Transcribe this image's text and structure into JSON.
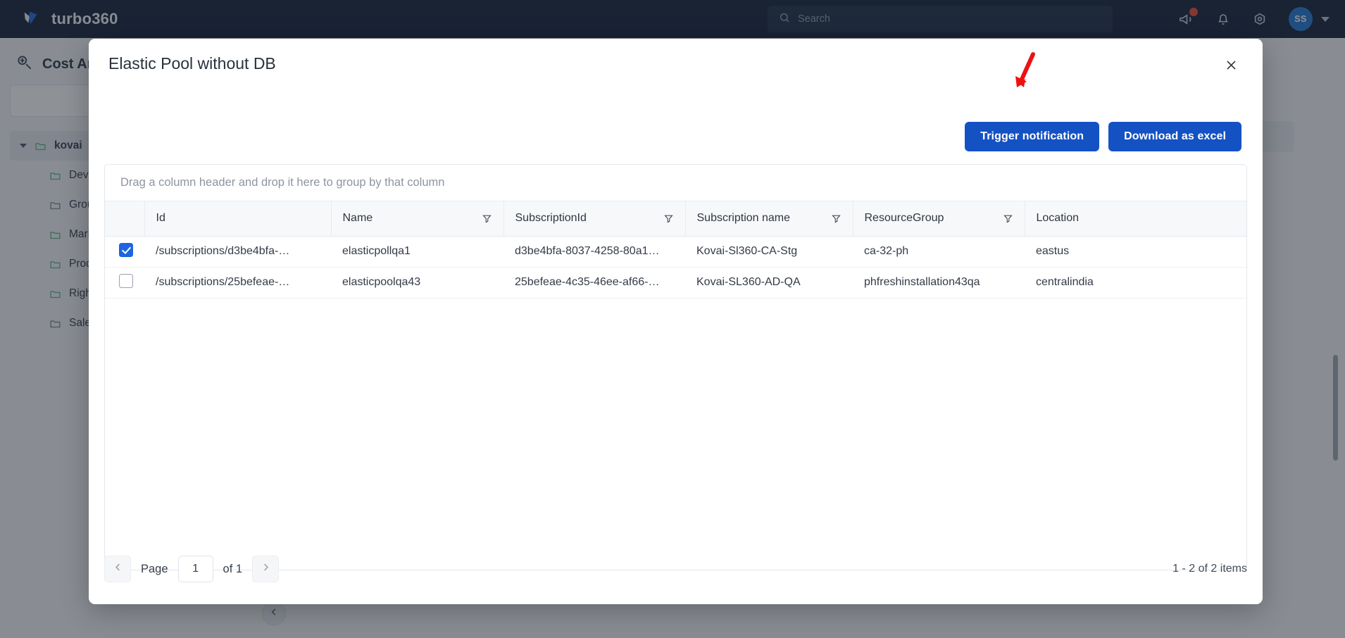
{
  "topbar": {
    "brand_name": "turbo360",
    "logo_icon": "turbo360-bird-logo",
    "search_placeholder": "Search",
    "search_value": "",
    "search_icon": "search-icon",
    "announce_icon": "megaphone-icon",
    "notification_icon": "bell-icon",
    "settings_icon": "gear-icon",
    "avatar_initials": "SS",
    "avatar_caret_icon": "chevron-down-icon",
    "badge_present": true
  },
  "background": {
    "page_title": "Cost Analysis",
    "page_icon": "cost-analysis-icon",
    "search_placeholder": "",
    "tree": [
      {
        "label": "kovai",
        "icon": "folder-icon",
        "level": 0,
        "expanded": true
      },
      {
        "label": "Development",
        "icon": "folder-icon",
        "level": 1
      },
      {
        "label": "Group",
        "icon": "folder-icon",
        "level": 1
      },
      {
        "label": "Marketing",
        "icon": "folder-icon",
        "level": 1
      },
      {
        "label": "Production",
        "icon": "folder-icon",
        "level": 1
      },
      {
        "label": "Rightsizing",
        "icon": "folder-icon",
        "level": 1
      },
      {
        "label": "Sales",
        "icon": "folder-icon",
        "level": 1
      }
    ],
    "collapse_icon": "chevron-left-icon"
  },
  "modal": {
    "title": "Elastic Pool without DB",
    "close_icon": "close-icon",
    "trigger_label": "Trigger notification",
    "download_label": "Download as excel",
    "annotation_arrow": "red-arrow-annotation",
    "accent_color": "#1452c4",
    "annotation_color": "#ee1111"
  },
  "grid": {
    "group_hint": "Drag a column header and drop it here to group by that column",
    "filter_icon": "filter-funnel-icon",
    "columns": [
      {
        "key": "id",
        "label": "Id",
        "filterable": false
      },
      {
        "key": "name",
        "label": "Name",
        "filterable": true
      },
      {
        "key": "subscriptionId",
        "label": "SubscriptionId",
        "filterable": true
      },
      {
        "key": "subscriptionName",
        "label": "Subscription name",
        "filterable": true
      },
      {
        "key": "resourceGroup",
        "label": "ResourceGroup",
        "filterable": true
      },
      {
        "key": "location",
        "label": "Location",
        "filterable": false
      }
    ],
    "rows": [
      {
        "selected": true,
        "id": "/subscriptions/d3be4bfa-…",
        "name": "elasticpollqa1",
        "subscriptionId": "d3be4bfa-8037-4258-80a1…",
        "subscriptionName": "Kovai-Sl360-CA-Stg",
        "resourceGroup": "ca-32-ph",
        "location": "eastus"
      },
      {
        "selected": false,
        "id": "/subscriptions/25befeae-…",
        "name": "elasticpoolqa43",
        "subscriptionId": "25befeae-4c35-46ee-af66-…",
        "subscriptionName": "Kovai-SL360-AD-QA",
        "resourceGroup": "phfreshinstallation43qa",
        "location": "centralindia"
      }
    ]
  },
  "pager": {
    "prev_icon": "chevron-left-icon",
    "next_icon": "chevron-right-icon",
    "page_label": "Page",
    "page_value": "1",
    "of_label": "of 1",
    "item_count": "1 - 2 of 2 items"
  }
}
